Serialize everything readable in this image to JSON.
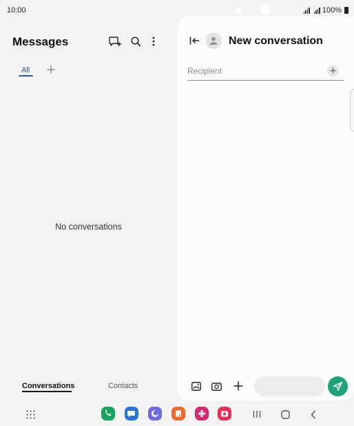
{
  "status_bar": {
    "time": "10:00",
    "battery": "100%"
  },
  "left_pane": {
    "title": "Messages",
    "tabs": [
      {
        "label": "All"
      }
    ],
    "empty_message": "No conversations",
    "bottom_tabs": [
      {
        "label": "Conversations"
      },
      {
        "label": "Contacts"
      }
    ]
  },
  "right_pane": {
    "title": "New conversation",
    "recipient_placeholder": "Recipient"
  },
  "colors": {
    "accent": "#1a5fb4",
    "send": "#1fa37a",
    "background": "#f3f3f3"
  },
  "dock_apps": [
    {
      "name": "phone-app-icon",
      "color": "#1ba362"
    },
    {
      "name": "messages-app-icon",
      "color": "#2a72d6"
    },
    {
      "name": "internet-app-icon",
      "color": "#6b6cd8"
    },
    {
      "name": "notes-app-icon",
      "color": "#f06a2b"
    },
    {
      "name": "gallery-app-icon",
      "color": "#d62a6e"
    },
    {
      "name": "camera-app-icon",
      "color": "#e3305a"
    }
  ]
}
